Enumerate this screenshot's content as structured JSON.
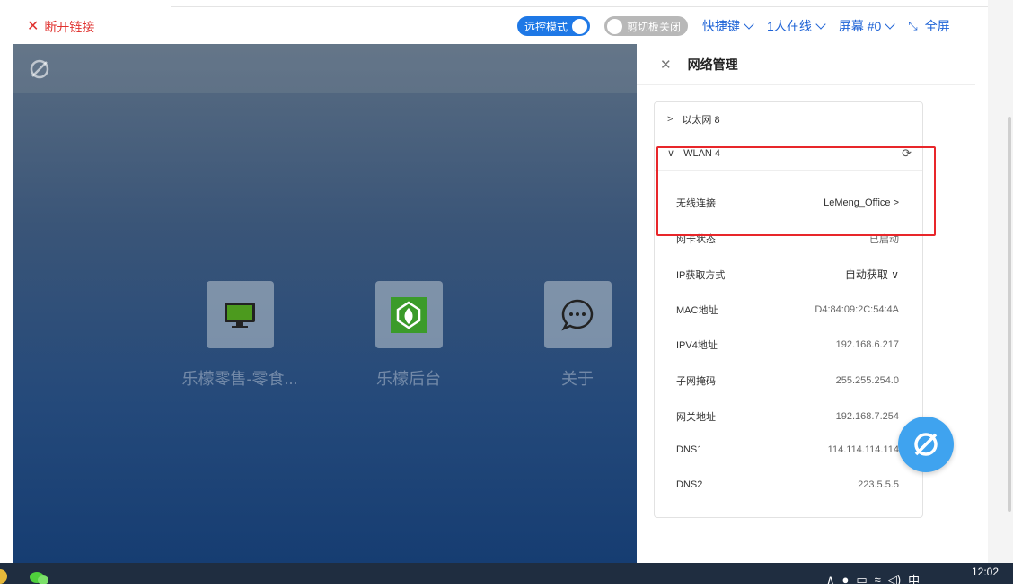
{
  "topbar": {
    "disconnect_label": "断开链接",
    "remote_mode_label": "远控模式",
    "clipboard_label": "剪切板关闭",
    "shortcuts_label": "快捷键",
    "online_label": "1人在线",
    "screen_label": "屏幕 #0",
    "fullscreen_label": "全屏"
  },
  "desktop": {
    "apps": [
      {
        "label": "乐檬零售-零食...",
        "icon": "monitor-icon"
      },
      {
        "label": "乐檬后台",
        "icon": "leaf-logo-icon"
      },
      {
        "label": "关于",
        "icon": "chat-bubble-icon"
      }
    ]
  },
  "panel": {
    "title": "网络管理",
    "ethernet_label": "以太网 8",
    "wlan_label": "WLAN 4",
    "rows": [
      {
        "label": "无线连接",
        "value": "LeMeng_Office"
      },
      {
        "label": "网卡状态",
        "value": "已启动"
      },
      {
        "label": "IP获取方式",
        "value": "自动获取"
      },
      {
        "label": "MAC地址",
        "value": "D4:84:09:2C:54:4A"
      },
      {
        "label": "IPV4地址",
        "value": "192.168.6.217"
      },
      {
        "label": "子网掩码",
        "value": "255.255.254.0"
      },
      {
        "label": "网关地址",
        "value": "192.168.7.254"
      },
      {
        "label": "DNS1",
        "value": "114.114.114.114"
      },
      {
        "label": "DNS2",
        "value": "223.5.5.5"
      }
    ]
  },
  "taskbar": {
    "clock": "12:02",
    "ime": "中"
  },
  "colors": {
    "accent": "#1e78e6",
    "danger": "#e0322f",
    "fab": "#3fa3ef"
  }
}
